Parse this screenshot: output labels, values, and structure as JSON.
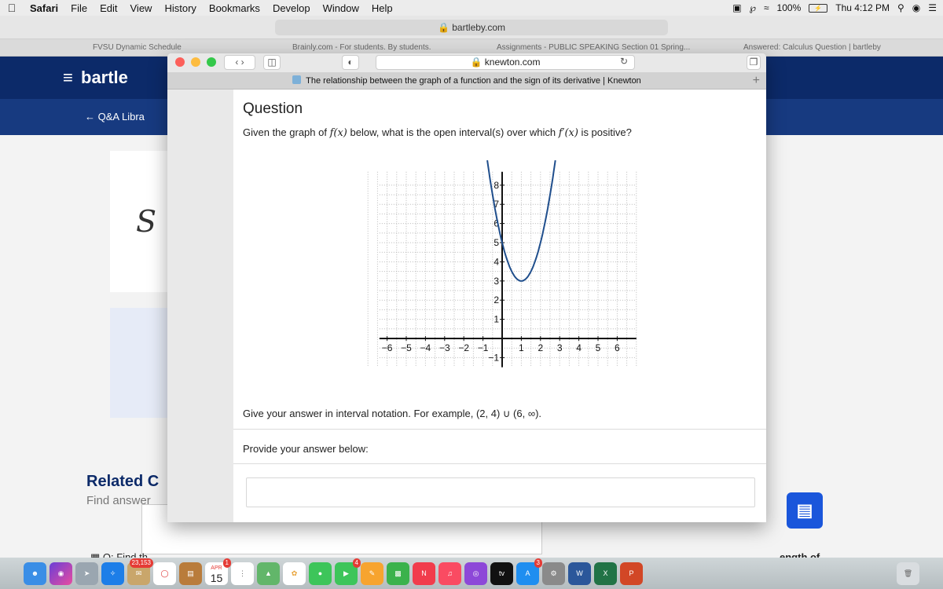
{
  "menubar": {
    "app": "Safari",
    "items": [
      "File",
      "Edit",
      "View",
      "History",
      "Bookmarks",
      "Develop",
      "Window",
      "Help"
    ],
    "battery": "100%",
    "clock": "Thu 4:12 PM"
  },
  "bg_window": {
    "url": "bartleby.com",
    "tabs": [
      "FVSU Dynamic Schedule",
      "Brainly.com - For students. By students.",
      "Assignments - PUBLIC SPEAKING Section 01 Spring...",
      "Answered: Calculus Question | bartleby"
    ],
    "logo": "bartle",
    "qa_library": "Q&A Libra",
    "related": "Related C",
    "find_answers": "Find answer",
    "q_find": "Q: Find th",
    "length_of": "ength of"
  },
  "fg_window": {
    "url": "knewton.com",
    "tab_title": "The relationship between the graph of a function and the sign of its derivative | Knewton",
    "question_title": "Question",
    "question_pre": "Given the graph of ",
    "question_f": "f(x)",
    "question_mid": " below, what is the open interval(s) over which ",
    "question_fp": "f′(x)",
    "question_post": " is positive?",
    "hint": "Give your answer in interval notation. For example, (2, 4) ∪ (6, ∞).",
    "provide": "Provide your answer below:",
    "answer_value": ""
  },
  "chart_data": {
    "type": "line",
    "title": "",
    "xlabel": "",
    "ylabel": "",
    "xlim": [
      -6.5,
      7
    ],
    "ylim": [
      -1.5,
      9
    ],
    "x_ticks": [
      -6,
      -5,
      -4,
      -3,
      -2,
      -1,
      1,
      2,
      3,
      4,
      5,
      6
    ],
    "y_ticks": [
      -1,
      1,
      2,
      3,
      4,
      5,
      6,
      7,
      8
    ],
    "grid": true,
    "series": [
      {
        "function": "f(x) = 2(x - 1)^2 + 3",
        "x": [
          -0.35,
          0,
          0.25,
          0.5,
          0.75,
          1,
          1.25,
          1.5,
          1.75,
          2,
          2.35
        ],
        "y": [
          6.6,
          5,
          4.1,
          3.5,
          3.1,
          3,
          3.1,
          3.5,
          4.1,
          5,
          6.6
        ],
        "color": "#1f4e8c"
      }
    ]
  },
  "dock": {
    "items": [
      "finder-icon",
      "siri-icon",
      "launchpad-icon",
      "safari-icon",
      "mail-icon",
      "chrome-icon",
      "notes-icon",
      "calendar-icon",
      "reminders-icon",
      "maps-icon",
      "photos-icon",
      "messages-icon",
      "facetime-icon",
      "pages-icon",
      "numbers-icon",
      "news-icon",
      "music-icon",
      "podcasts-icon",
      "tv-icon",
      "app-store-icon",
      "system-preferences-icon",
      "word-icon",
      "excel-icon",
      "powerpoint-icon",
      "trash-icon"
    ],
    "mail_badge": "23,153",
    "calendar_month": "APR",
    "calendar_day": "15",
    "calendar_badge": "1",
    "facetime_badge": "4",
    "appstore_badge": "3",
    "tv_label": "tv"
  }
}
